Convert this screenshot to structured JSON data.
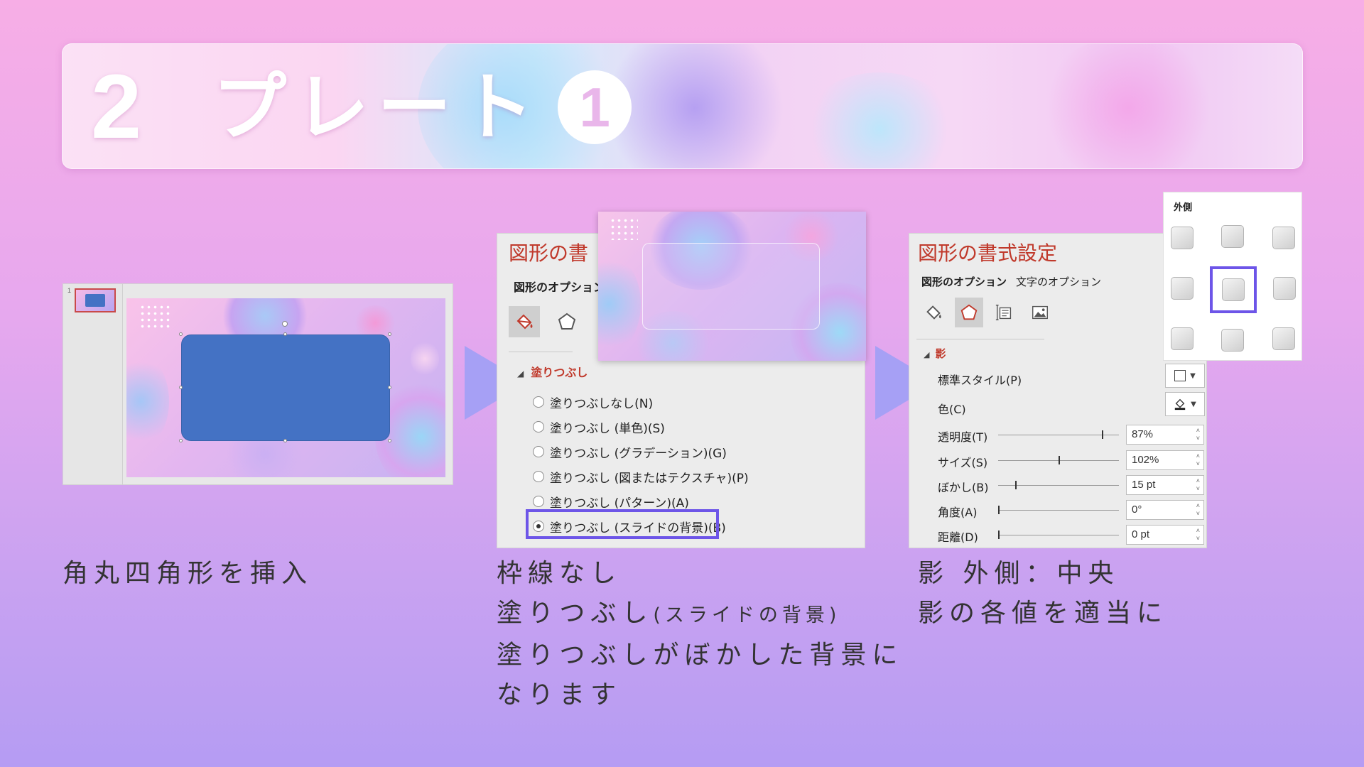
{
  "header": {
    "number": "2",
    "title": "プレート",
    "circle_number": "1"
  },
  "step1": {
    "thumbnail_index": "1",
    "caption": "角丸四角形を挿入"
  },
  "step2": {
    "panel_title": "図形の書",
    "tab": "図形のオプション",
    "section": "塗りつぶし",
    "options": [
      "塗りつぶしなし(N)",
      "塗りつぶし (単色)(S)",
      "塗りつぶし (グラデーション)(G)",
      "塗りつぶし (図またはテクスチャ)(P)",
      "塗りつぶし (パターン)(A)",
      "塗りつぶし (スライドの背景)(B)"
    ],
    "caption_line1": "枠線なし",
    "caption_line2_main": "塗りつぶし",
    "caption_line2_small": "(スライドの背景)",
    "caption_line3": "塗りつぶしがぼかした背景に",
    "caption_line4": "なります"
  },
  "step3": {
    "panel_title": "図形の書式設定",
    "tab_shape": "図形のオプション",
    "tab_text": "文字のオプション",
    "section": "影",
    "preset_label": "標準スタイル(P)",
    "color_label": "色(C)",
    "transparency_label": "透明度(T)",
    "transparency_value": "87%",
    "size_label": "サイズ(S)",
    "size_value": "102%",
    "blur_label": "ぼかし(B)",
    "blur_value": "15 pt",
    "angle_label": "角度(A)",
    "angle_value": "0°",
    "distance_label": "距離(D)",
    "distance_value": "0 pt",
    "outer_title": "外側",
    "caption_line1": "影 外側：中央",
    "caption_line2": "影の各値を適当に"
  },
  "colors": {
    "accent_highlight": "#6d55e8",
    "panel_title": "#c0392b",
    "rounded_rect": "#4472c4",
    "arrow": "#a6a0f5"
  }
}
